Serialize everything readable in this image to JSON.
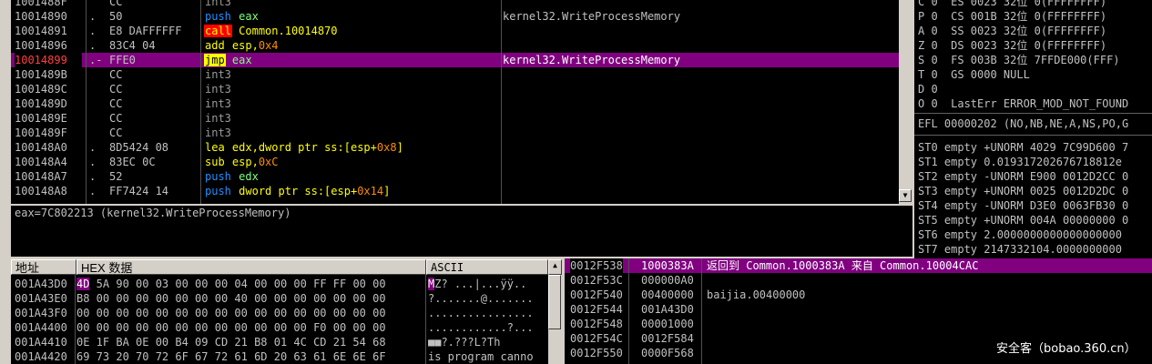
{
  "disasm": {
    "rows": [
      {
        "addr": "1001488F",
        "mark": "",
        "hex": "CC",
        "mnem": "int3",
        "mclass": "k-int",
        "ops": [],
        "comment": ""
      },
      {
        "addr": "10014890",
        "mark": ".",
        "hex": "50",
        "mnem": "push",
        "mclass": "k-push",
        "ops": [
          {
            "t": "eax",
            "c": "op-push"
          }
        ],
        "comment": "kernel32.WriteProcessMemory"
      },
      {
        "addr": "10014891",
        "mark": ".",
        "hex": "E8 DAFFFFFF",
        "mnem": "call",
        "mclass": "k-call",
        "ops": [
          {
            "t": "Common.10014870",
            "c": "op"
          }
        ],
        "comment": ""
      },
      {
        "addr": "10014896",
        "mark": ".",
        "hex": "83C4 04",
        "mnem": "add",
        "mclass": "k-add",
        "ops": [
          {
            "t": "esp,",
            "c": "op"
          },
          {
            "t": "0x4",
            "c": "hexnum"
          }
        ],
        "comment": ""
      },
      {
        "addr": "10014899",
        "mark": ".-",
        "hex": "FFE0",
        "mnem": "jmp",
        "mclass": "k-jmp",
        "ops": [
          {
            "t": "eax",
            "c": "op-push"
          }
        ],
        "comment": "kernel32.WriteProcessMemory",
        "selected": true
      },
      {
        "addr": "1001489B",
        "mark": "",
        "hex": "CC",
        "mnem": "int3",
        "mclass": "k-int",
        "ops": [],
        "comment": ""
      },
      {
        "addr": "1001489C",
        "mark": "",
        "hex": "CC",
        "mnem": "int3",
        "mclass": "k-int",
        "ops": [],
        "comment": ""
      },
      {
        "addr": "1001489D",
        "mark": "",
        "hex": "CC",
        "mnem": "int3",
        "mclass": "k-int",
        "ops": [],
        "comment": ""
      },
      {
        "addr": "1001489E",
        "mark": "",
        "hex": "CC",
        "mnem": "int3",
        "mclass": "k-int",
        "ops": [],
        "comment": ""
      },
      {
        "addr": "1001489F",
        "mark": "",
        "hex": "CC",
        "mnem": "int3",
        "mclass": "k-int",
        "ops": [],
        "comment": ""
      },
      {
        "addr": "100148A0",
        "mark": ".",
        "hex": "8D5424 08",
        "mnem": "lea",
        "mclass": "k-lea",
        "ops": [
          {
            "t": "edx,dword ptr ss:[esp+",
            "c": "op"
          },
          {
            "t": "0x8",
            "c": "hexnum"
          },
          {
            "t": "]",
            "c": "op"
          }
        ],
        "comment": ""
      },
      {
        "addr": "100148A4",
        "mark": ".",
        "hex": "83EC 0C",
        "mnem": "sub",
        "mclass": "k-sub",
        "ops": [
          {
            "t": "esp,",
            "c": "op"
          },
          {
            "t": "0xC",
            "c": "hexnum"
          }
        ],
        "comment": ""
      },
      {
        "addr": "100148A7",
        "mark": ".",
        "hex": "52",
        "mnem": "push",
        "mclass": "k-push",
        "ops": [
          {
            "t": "edx",
            "c": "op-push"
          }
        ],
        "comment": ""
      },
      {
        "addr": "100148A8",
        "mark": ".",
        "hex": "FF7424 14",
        "mnem": "push",
        "mclass": "k-push",
        "ops": [
          {
            "t": "dword ptr ss:[esp+",
            "c": "op"
          },
          {
            "t": "0x14",
            "c": "hexnum"
          },
          {
            "t": "]",
            "c": "op"
          }
        ],
        "comment": ""
      }
    ]
  },
  "info": {
    "line": "eax=7C802213 (kernel32.WriteProcessMemory)"
  },
  "registers": {
    "flags": [
      "C 0  ES 0023 32位 0(FFFFFFFF)",
      "P 0  CS 001B 32位 0(FFFFFFFF)",
      "A 0  SS 0023 32位 0(FFFFFFFF)",
      "Z 0  DS 0023 32位 0(FFFFFFFF)",
      "S 0  FS 003B 32位 7FFDE000(FFF)",
      "T 0  GS 0000 NULL",
      "D 0",
      "O 0  LastErr ERROR_MOD_NOT_FOUND"
    ],
    "efl": "EFL 00000202 (NO,NB,NE,A,NS,PO,G",
    "fpu": [
      "ST0 empty +UNORM 4029 7C99D600 7",
      "ST1 empty 0.019317202676718812e",
      "ST2 empty -UNORM E900 0012D2CC 0",
      "ST3 empty +UNORM 0025 0012D2DC 0",
      "ST4 empty -UNORM D3E0 0063FB30 0",
      "ST5 empty +UNORM 004A 00000000 0",
      "ST6 empty 2.0000000000000000000",
      "ST7 empty 2147332104.0000000000"
    ]
  },
  "dump": {
    "col_addr": "地址",
    "col_hex": "HEX 数据",
    "col_ascii": "ASCII",
    "rows": [
      {
        "addr": "001A43D0",
        "first": "4D",
        "hex": " 5A 90 00 03 00 00 00 04 00 00 00 FF FF 00 00",
        "afirst": "M",
        "ascii": "Z? ...|...ÿÿ.."
      },
      {
        "addr": "001A43E0",
        "first": "",
        "hex": "B8 00 00 00 00 00 00 00 40 00 00 00 00 00 00 00",
        "afirst": "",
        "ascii": "?.......@......."
      },
      {
        "addr": "001A43F0",
        "first": "",
        "hex": "00 00 00 00 00 00 00 00 00 00 00 00 00 00 00 00",
        "afirst": "",
        "ascii": "................"
      },
      {
        "addr": "001A4400",
        "first": "",
        "hex": "00 00 00 00 00 00 00 00 00 00 00 00 F0 00 00 00",
        "afirst": "",
        "ascii": "............?..."
      },
      {
        "addr": "001A4410",
        "first": "",
        "hex": "0E 1F BA 0E 00 B4 09 CD 21 B8 01 4C CD 21 54 68",
        "afirst": "",
        "ascii": "■■?.???L?Th"
      },
      {
        "addr": "001A4420",
        "first": "",
        "hex": "69 73 20 70 72 6F 67 72 61 6D 20 63 61 6E 6E 6F",
        "afirst": "",
        "ascii": "is program canno"
      }
    ]
  },
  "stack": {
    "rows": [
      {
        "addr": "0012F538",
        "val": "1000383A",
        "cmt": "返回到 Common.1000383A 来自 Common.10004CAC",
        "selected": true
      },
      {
        "addr": "0012F53C",
        "val": "000000A0",
        "cmt": ""
      },
      {
        "addr": "0012F540",
        "val": "00400000",
        "cmt": "baijia.00400000"
      },
      {
        "addr": "0012F544",
        "val": "001A43D0",
        "cmt": ""
      },
      {
        "addr": "0012F548",
        "val": "00001000",
        "cmt": ""
      },
      {
        "addr": "0012F54C",
        "val": "0012F584",
        "cmt": ""
      },
      {
        "addr": "0012F550",
        "val": "0000F568",
        "cmt": ""
      }
    ]
  },
  "watermark": "安全客（bobao.360.cn）"
}
